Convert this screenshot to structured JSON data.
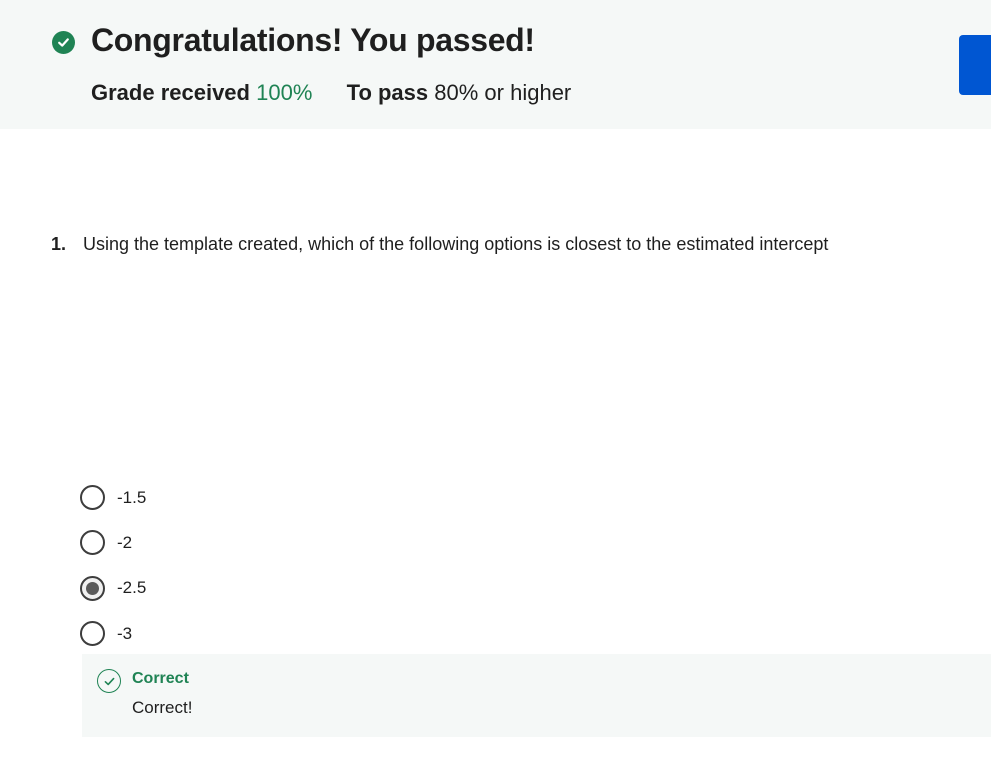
{
  "banner": {
    "title": "Congratulations! You passed!",
    "grade_label": "Grade received",
    "grade_value": "100%",
    "pass_label": "To pass",
    "pass_value": "80% or higher",
    "status_icon": "check-circle-filled-icon",
    "accent_color": "#1f8354"
  },
  "next_button": {
    "color": "#0056d2"
  },
  "question": {
    "number": "1.",
    "text": "Using the template created, which of the following options is closest to the estimated intercept"
  },
  "options": [
    {
      "label": "-1.5",
      "selected": false
    },
    {
      "label": "-2",
      "selected": false
    },
    {
      "label": "-2.5",
      "selected": true
    },
    {
      "label": "-3",
      "selected": false
    }
  ],
  "feedback": {
    "title": "Correct",
    "text": "Correct!",
    "icon": "check-circle-outline-icon"
  }
}
